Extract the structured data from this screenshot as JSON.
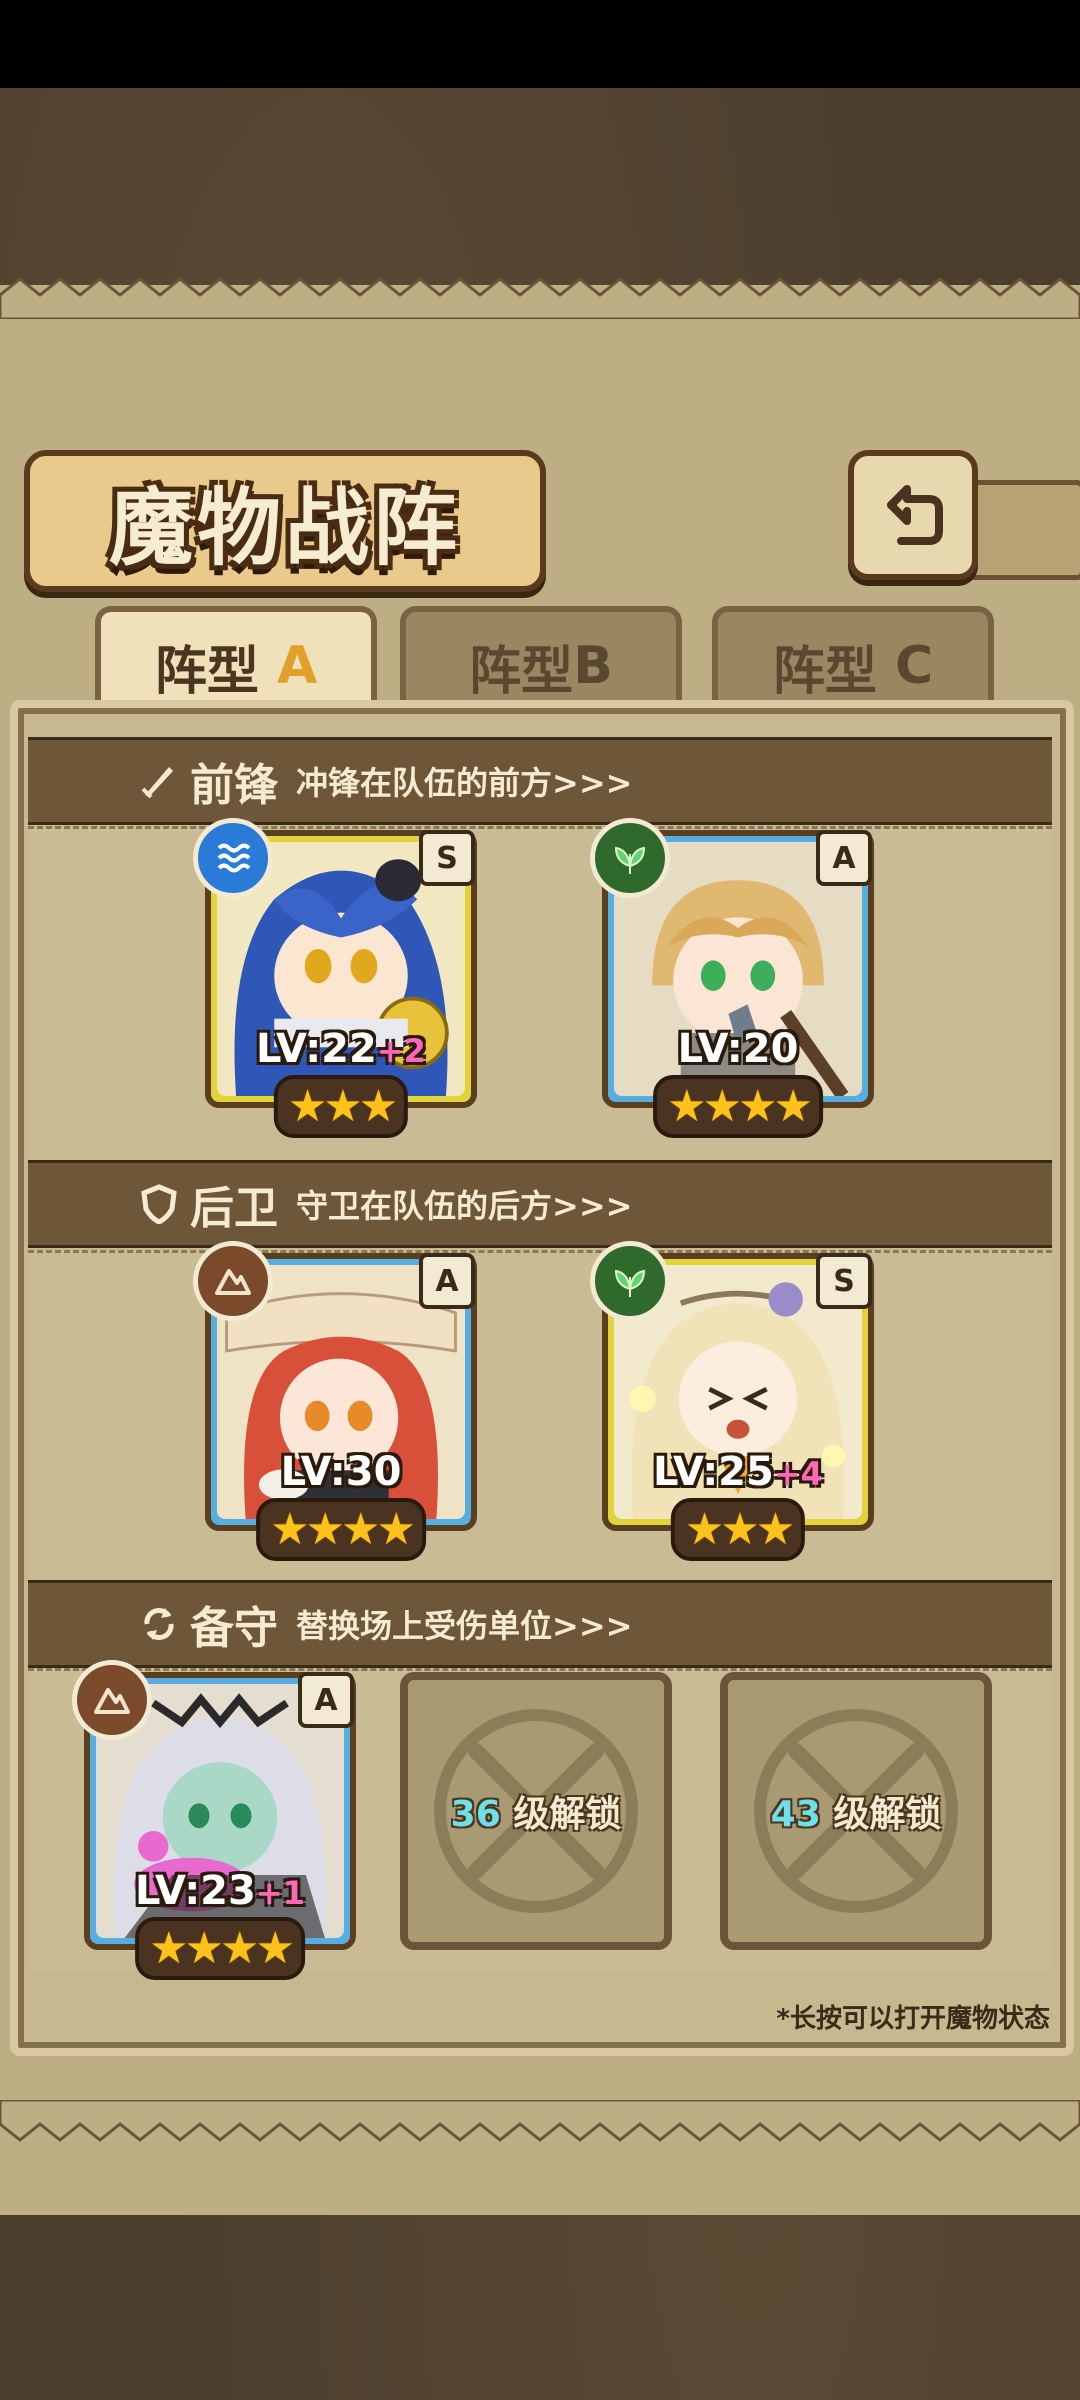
{
  "title": "魔物战阵",
  "tabs": [
    {
      "label": "阵型",
      "suffix": "A"
    },
    {
      "label": "阵型",
      "suffix": "B"
    },
    {
      "label": "阵型",
      "suffix": "C"
    }
  ],
  "sections": {
    "front": {
      "name": "前锋",
      "desc": "冲锋在队伍的前方>>>"
    },
    "back": {
      "name": "后卫",
      "desc": "守卫在队伍的后方>>>"
    },
    "reserve": {
      "name": "备守",
      "desc": "替换场上受伤单位>>>"
    }
  },
  "monsters": [
    {
      "rank": "S",
      "lv": "LV:22",
      "plus": "+2",
      "stars": "★★★",
      "element": "water-icon"
    },
    {
      "rank": "A",
      "lv": "LV:20",
      "plus": "",
      "stars": "★★★★",
      "element": "leaf-icon"
    },
    {
      "rank": "A",
      "lv": "LV:30",
      "plus": "",
      "stars": "★★★★",
      "element": "earth-icon"
    },
    {
      "rank": "S",
      "lv": "LV:25",
      "plus": "+4",
      "stars": "★★★",
      "element": "leaf-icon"
    },
    {
      "rank": "A",
      "lv": "LV:23",
      "plus": "+1",
      "stars": "★★★★",
      "element": "earth-icon"
    }
  ],
  "locked_slots": [
    {
      "level": "36",
      "text": "级解锁"
    },
    {
      "level": "43",
      "text": "级解锁"
    }
  ],
  "hint": "*长按可以打开魔物状态",
  "colors": {
    "rank_S": "#e3d33a",
    "rank_A": "#56aee0",
    "panel": "#bdae84",
    "band": "#6e5638"
  }
}
